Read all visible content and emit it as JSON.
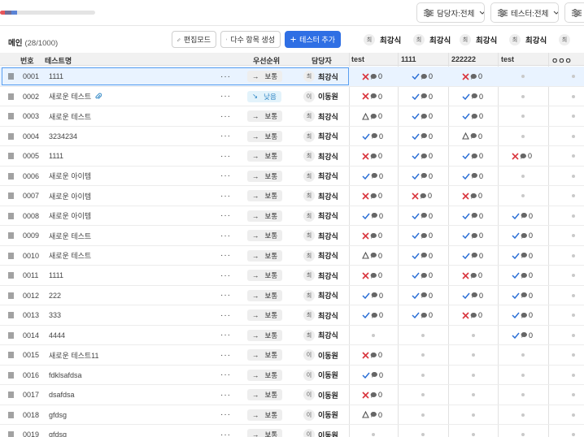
{
  "progress": {
    "segments": [
      {
        "color": "#e8555a",
        "fraction": 0.05
      },
      {
        "color": "#6f6f9b",
        "fraction": 0.07
      },
      {
        "color": "#5b84d6",
        "fraction": 0.06
      }
    ]
  },
  "filters": [
    {
      "label": "담당자:전체",
      "icon": "sliders-icon"
    },
    {
      "label": "테스터:전체",
      "icon": "sliders-icon"
    },
    {
      "label": "우",
      "icon": "sliders-icon"
    }
  ],
  "toolbar": {
    "title": "메인",
    "count": "(28/1000)",
    "edit_mode": "편집모드",
    "bulk_create": "다수 항목 생성",
    "add_tester": "테스터 추가"
  },
  "columns": {
    "number": "번호",
    "test_name": "테스트명",
    "priority": "우선순위",
    "assignee": "담당자"
  },
  "testers": [
    {
      "avatar": "최",
      "name": "최강식",
      "label": "test"
    },
    {
      "avatar": "최",
      "name": "최강식",
      "label": "1111"
    },
    {
      "avatar": "최",
      "name": "최강식",
      "label": "222222"
    },
    {
      "avatar": "최",
      "name": "최강식",
      "label": "test"
    },
    {
      "avatar": "최",
      "name": "",
      "label": "ㅇㅇㅇ"
    }
  ],
  "rows": [
    {
      "no": "0001",
      "name": "1111",
      "priority": "보통",
      "arrow": "→",
      "low": false,
      "av": "최",
      "assignee": "최강식",
      "results": [
        "x0",
        "c0",
        "x0",
        "d",
        "d"
      ]
    },
    {
      "no": "0002",
      "name": "새로운 테스트",
      "clip": true,
      "priority": "낮음",
      "arrow": "↘",
      "low": true,
      "av": "이",
      "assignee": "이동원",
      "results": [
        "x0",
        "c0",
        "c0",
        "d",
        "d"
      ]
    },
    {
      "no": "0003",
      "name": "새로운 테스트",
      "priority": "보통",
      "arrow": "→",
      "low": false,
      "av": "최",
      "assignee": "최강식",
      "results": [
        "t0",
        "c0",
        "c0",
        "d",
        "d"
      ]
    },
    {
      "no": "0004",
      "name": "3234234",
      "priority": "보통",
      "arrow": "→",
      "low": false,
      "av": "최",
      "assignee": "최강식",
      "results": [
        "c0",
        "c0",
        "t0",
        "d",
        "d"
      ]
    },
    {
      "no": "0005",
      "name": "1111",
      "priority": "보통",
      "arrow": "→",
      "low": false,
      "av": "최",
      "assignee": "최강식",
      "results": [
        "x0",
        "c0",
        "c0",
        "x0",
        "d"
      ]
    },
    {
      "no": "0006",
      "name": "새로운 아이템",
      "priority": "보통",
      "arrow": "→",
      "low": false,
      "av": "최",
      "assignee": "최강식",
      "results": [
        "c0",
        "c0",
        "c0",
        "d",
        "d"
      ]
    },
    {
      "no": "0007",
      "name": "새로운 아이템",
      "priority": "보통",
      "arrow": "→",
      "low": false,
      "av": "최",
      "assignee": "최강식",
      "results": [
        "x0",
        "x0",
        "x0",
        "d",
        "d"
      ]
    },
    {
      "no": "0008",
      "name": "새로운 아이템",
      "priority": "보통",
      "arrow": "→",
      "low": false,
      "av": "최",
      "assignee": "최강식",
      "results": [
        "c0",
        "c0",
        "c0",
        "c0",
        "d"
      ]
    },
    {
      "no": "0009",
      "name": "새로운 테스트",
      "priority": "보통",
      "arrow": "→",
      "low": false,
      "av": "최",
      "assignee": "최강식",
      "results": [
        "x0",
        "c0",
        "c0",
        "c0",
        "d"
      ]
    },
    {
      "no": "0010",
      "name": "새로운 테스트",
      "priority": "보통",
      "arrow": "→",
      "low": false,
      "av": "최",
      "assignee": "최강식",
      "results": [
        "t0",
        "c0",
        "c0",
        "c0",
        "d"
      ]
    },
    {
      "no": "0011",
      "name": "1111",
      "priority": "보통",
      "arrow": "→",
      "low": false,
      "av": "최",
      "assignee": "최강식",
      "results": [
        "x0",
        "c0",
        "x0",
        "c0",
        "d"
      ]
    },
    {
      "no": "0012",
      "name": "222",
      "priority": "보통",
      "arrow": "→",
      "low": false,
      "av": "최",
      "assignee": "최강식",
      "results": [
        "c0",
        "c0",
        "c0",
        "c0",
        "d"
      ]
    },
    {
      "no": "0013",
      "name": "333",
      "priority": "보통",
      "arrow": "→",
      "low": false,
      "av": "최",
      "assignee": "최강식",
      "results": [
        "c0",
        "c0",
        "x0",
        "c0",
        "d"
      ]
    },
    {
      "no": "0014",
      "name": "4444",
      "priority": "보통",
      "arrow": "→",
      "low": false,
      "av": "최",
      "assignee": "최강식",
      "results": [
        "d",
        "d",
        "d",
        "c0",
        "d"
      ]
    },
    {
      "no": "0015",
      "name": "새로운 테스트11",
      "priority": "보통",
      "arrow": "→",
      "low": false,
      "av": "이",
      "assignee": "이동원",
      "results": [
        "x0",
        "d",
        "d",
        "d",
        "d"
      ]
    },
    {
      "no": "0016",
      "name": "fdklsafdsa",
      "priority": "보통",
      "arrow": "→",
      "low": false,
      "av": "이",
      "assignee": "이동원",
      "results": [
        "c0",
        "d",
        "d",
        "d",
        "d"
      ]
    },
    {
      "no": "0017",
      "name": "dsafdsa",
      "priority": "보통",
      "arrow": "→",
      "low": false,
      "av": "이",
      "assignee": "이동원",
      "results": [
        "x0",
        "d",
        "d",
        "d",
        "d"
      ]
    },
    {
      "no": "0018",
      "name": "gfdsg",
      "priority": "보통",
      "arrow": "→",
      "low": false,
      "av": "이",
      "assignee": "이동원",
      "results": [
        "t0",
        "d",
        "d",
        "d",
        "d"
      ]
    },
    {
      "no": "0019",
      "name": "gfdsg",
      "priority": "보통",
      "arrow": "→",
      "low": false,
      "av": "이",
      "assignee": "이동원",
      "results": [
        "d",
        "d",
        "d",
        "d",
        "d"
      ]
    }
  ],
  "result_count": "0",
  "colors": {
    "fail": "#d9363e",
    "pass": "#2b6fd6",
    "blocked": "#555555",
    "comment": "#666666",
    "primary": "#2f6fe4"
  }
}
